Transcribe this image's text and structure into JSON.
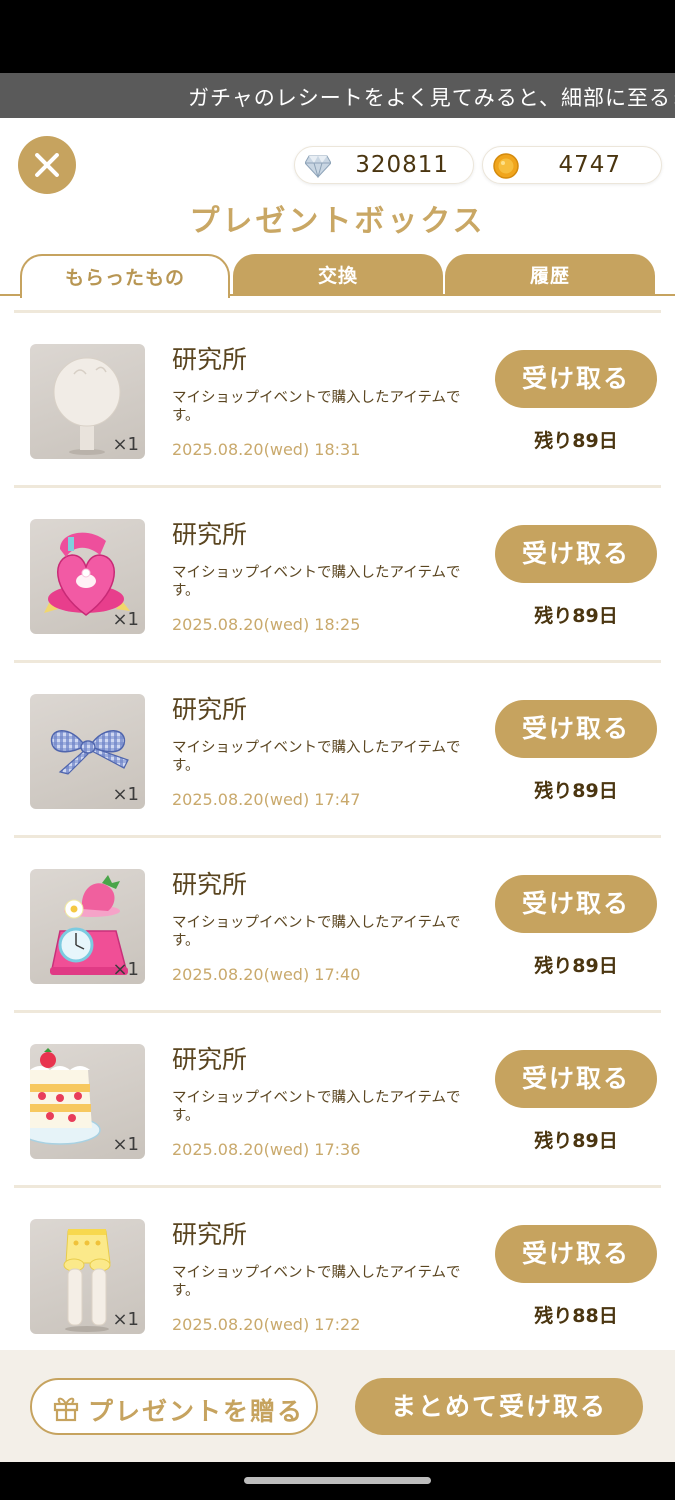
{
  "ticker": {
    "text": "ガチャのレシートをよく見てみると、細部に至るま"
  },
  "header": {
    "title": "プレゼントボックス",
    "gems": "320811",
    "coins": "4747"
  },
  "tabs": [
    {
      "label": "もらったもの"
    },
    {
      "label": "交換"
    },
    {
      "label": "履歴"
    }
  ],
  "items": [
    {
      "name": "研究所",
      "desc": "マイショップイベントで購入したアイテムです。",
      "date": "2025.08.20(wed) 18:31",
      "qty": "×1",
      "button": "受け取る",
      "remaining": "残り89日",
      "icon": "head-base-icon"
    },
    {
      "name": "研究所",
      "desc": "マイショップイベントで購入したアイテムです。",
      "date": "2025.08.20(wed) 18:25",
      "qty": "×1",
      "button": "受け取る",
      "remaining": "残り89日",
      "icon": "heart-ring-box-icon"
    },
    {
      "name": "研究所",
      "desc": "マイショップイベントで購入したアイテムです。",
      "date": "2025.08.20(wed) 17:47",
      "qty": "×1",
      "button": "受け取る",
      "remaining": "残り89日",
      "icon": "gingham-ribbon-icon"
    },
    {
      "name": "研究所",
      "desc": "マイショップイベントで購入したアイテムです。",
      "date": "2025.08.20(wed) 17:40",
      "qty": "×1",
      "button": "受け取る",
      "remaining": "残り89日",
      "icon": "strawberry-scale-icon"
    },
    {
      "name": "研究所",
      "desc": "マイショップイベントで購入したアイテムです。",
      "date": "2025.08.20(wed) 17:36",
      "qty": "×1",
      "button": "受け取る",
      "remaining": "残り89日",
      "icon": "shortcake-icon"
    },
    {
      "name": "研究所",
      "desc": "マイショップイベントで購入したアイテムです。",
      "date": "2025.08.20(wed) 17:22",
      "qty": "×1",
      "button": "受け取る",
      "remaining": "残り88日",
      "icon": "bloomers-icon"
    }
  ],
  "footer": {
    "gift_label": "プレゼントを贈る",
    "receive_all_label": "まとめて受け取る"
  },
  "colors": {
    "accent": "#c6a35f",
    "text_dark": "#4a3510",
    "date": "#c9a96c"
  }
}
